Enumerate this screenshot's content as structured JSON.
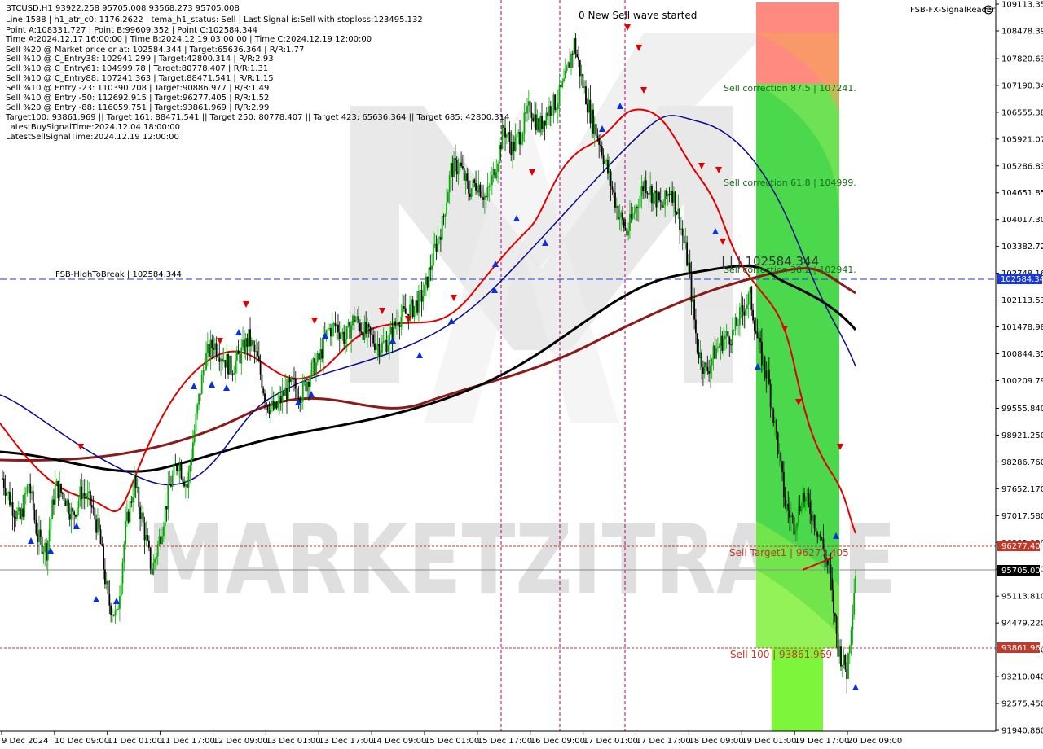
{
  "info_panel": {
    "lines": [
      "BTCUSD,H1  93922.258 95705.008 93568.273 95705.008",
      "Line:1588 | h1_atr_c0: 1176.2622 | tema_h1_status: Sell | Last Signal is:Sell with stoploss:123495.132",
      "Point A:108331.727 | Point B:99609.352 | Point C:102584.344",
      "Time A:2024.12.17 16:00:00 | Time B:2024.12.19 03:00:00 | Time C:2024.12.19 12:00:00",
      "Sell %20 @ Market price or at: 102584.344 | Target:65636.364 | R/R:1.77",
      "Sell %10 @ C_Entry38: 102941.299 | Target:42800.314 | R/R:2.93",
      "Sell %10 @ C_Entry61: 104999.78 | Target:80778.407 | R/R:1.31",
      "Sell %10 @ C_Entry88: 107241.363 | Target:88471.541 | R/R:1.15",
      "Sell %10 @ Entry -23: 110390.208 | Target:90886.977 | R/R:1.49",
      "Sell %10 @ Entry -50: 112692.915 | Target:96277.405 | R/R:1.52",
      "Sell %20 @ Entry -88: 116059.751 | Target:93861.969 | R/R:2.99",
      "Target100: 93861.969 || Target 161: 88471.541 || Target 250: 80778.407 || Target 423: 65636.364 || Target 685: 42800.314",
      "LatestBuySignalTime:2024.12.04 18:00:00",
      "LatestSellSignalTime:2024.12.19 12:00:00"
    ]
  },
  "indicator_name": "FSB-FX-SignalReader",
  "wave_label": "0 New Sell wave started",
  "watermark": "MARKETZITRADE",
  "fib_labels": {
    "sell_87": "Sell correction 87.5 | 107241.",
    "sell_61": "Sell correction 61.8 | 104999.",
    "sell_38": "Sell correction 38.2 | 102941.",
    "point_c": "| | | 102584.344",
    "target1": "Sell Target1 | 96277.405",
    "sell100": "Sell 100 | 93861.969"
  },
  "high_to_break_label": "FSB-HighToBreak | 102584.344",
  "price_tags": {
    "high_to_break": "102584.344",
    "target1": "96277.405",
    "current": "95705.008",
    "sell100": "93861.969"
  },
  "colors": {
    "bull_candle": "#00aa00",
    "bear_candle": "#000000",
    "ema_fast": "#e00000",
    "ema_slow": "#0a0a8c",
    "ma_long": "#000000",
    "ma_longer": "#8b1a1a",
    "buy_arrow": "#0a2ee0",
    "sell_arrow": "#e00000",
    "tag_blue": "#1a3ad6",
    "tag_red": "#c0392b",
    "sell_zone_red": "#ff8a80",
    "sell_zone_green": "#4cd84c"
  },
  "chart_data": {
    "type": "candlestick",
    "symbol": "BTCUSD",
    "timeframe": "H1",
    "ylim": [
      91940.86,
      109113.35
    ],
    "y_ticks": [
      "109113.350",
      "108478.390",
      "107820.630",
      "107190.345",
      "106555.380",
      "105921.070",
      "105286.830",
      "104651.850",
      "104017.300",
      "103382.720",
      "102748.160",
      "102113.530",
      "101478.980",
      "100844.350",
      "100209.790",
      "99555.840",
      "98921.250",
      "98286.760",
      "97652.170",
      "97017.580",
      "96382.990",
      "95748.400",
      "95113.810",
      "94479.220",
      "93844.630",
      "93210.040",
      "92575.450",
      "91940.860"
    ],
    "x_ticks": [
      "9 Dec 2024",
      "10 Dec 09:00",
      "11 Dec 01:00",
      "11 Dec 17:00",
      "12 Dec 09:00",
      "13 Dec 01:00",
      "13 Dec 17:00",
      "14 Dec 09:00",
      "15 Dec 01:00",
      "15 Dec 17:00",
      "16 Dec 09:00",
      "17 Dec 01:00",
      "17 Dec 17:00",
      "18 Dec 09:00",
      "19 Dec 01:00",
      "19 Dec 17:00",
      "20 Dec 09:00"
    ],
    "levels": {
      "high_to_break": 102584.344,
      "sell_target1": 96277.405,
      "current_price": 95705.008,
      "sell_100": 93861.969
    },
    "close_path": [
      [
        0,
        97900
      ],
      [
        6,
        97300
      ],
      [
        12,
        96900
      ],
      [
        18,
        97800
      ],
      [
        24,
        96500
      ],
      [
        30,
        96200
      ],
      [
        36,
        97700
      ],
      [
        42,
        97500
      ],
      [
        48,
        97000
      ],
      [
        54,
        97600
      ],
      [
        60,
        97300
      ],
      [
        66,
        96600
      ],
      [
        72,
        95000
      ],
      [
        78,
        94600
      ],
      [
        84,
        96700
      ],
      [
        90,
        97800
      ],
      [
        96,
        96800
      ],
      [
        102,
        95700
      ],
      [
        108,
        96600
      ],
      [
        114,
        97700
      ],
      [
        120,
        98300
      ],
      [
        126,
        97700
      ],
      [
        132,
        99300
      ],
      [
        138,
        100700
      ],
      [
        144,
        101100
      ],
      [
        150,
        100800
      ],
      [
        156,
        100500
      ],
      [
        162,
        100800
      ],
      [
        168,
        101200
      ],
      [
        174,
        100700
      ],
      [
        180,
        99700
      ],
      [
        186,
        99500
      ],
      [
        192,
        99900
      ],
      [
        198,
        100100
      ],
      [
        204,
        99900
      ],
      [
        210,
        100400
      ],
      [
        216,
        100700
      ],
      [
        222,
        101400
      ],
      [
        228,
        101500
      ],
      [
        234,
        101200
      ],
      [
        240,
        101700
      ],
      [
        246,
        101400
      ],
      [
        252,
        101200
      ],
      [
        258,
        101000
      ],
      [
        264,
        101200
      ],
      [
        270,
        101700
      ],
      [
        276,
        101800
      ],
      [
        282,
        102000
      ],
      [
        288,
        102300
      ],
      [
        294,
        103200
      ],
      [
        300,
        103900
      ],
      [
        306,
        105200
      ],
      [
        312,
        105300
      ],
      [
        318,
        104700
      ],
      [
        324,
        104900
      ],
      [
        330,
        104500
      ],
      [
        336,
        105200
      ],
      [
        342,
        106200
      ],
      [
        348,
        105700
      ],
      [
        354,
        106100
      ],
      [
        360,
        106700
      ],
      [
        366,
        106200
      ],
      [
        372,
        106600
      ],
      [
        378,
        106800
      ],
      [
        384,
        107300
      ],
      [
        390,
        108200
      ],
      [
        396,
        107200
      ],
      [
        402,
        106400
      ],
      [
        408,
        105800
      ],
      [
        414,
        105000
      ],
      [
        420,
        104200
      ],
      [
        426,
        103700
      ],
      [
        432,
        104300
      ],
      [
        438,
        104900
      ],
      [
        444,
        104600
      ],
      [
        450,
        104300
      ],
      [
        456,
        104800
      ],
      [
        462,
        104000
      ],
      [
        468,
        102900
      ],
      [
        474,
        101000
      ],
      [
        480,
        100400
      ],
      [
        486,
        100900
      ],
      [
        492,
        101200
      ],
      [
        498,
        101300
      ],
      [
        504,
        101800
      ],
      [
        510,
        102200
      ],
      [
        516,
        101000
      ],
      [
        522,
        100300
      ],
      [
        528,
        98900
      ],
      [
        534,
        97300
      ],
      [
        540,
        96800
      ],
      [
        546,
        97500
      ],
      [
        552,
        97100
      ],
      [
        558,
        96500
      ],
      [
        564,
        95700
      ],
      [
        570,
        93900
      ],
      [
        576,
        93300
      ],
      [
        582,
        95705
      ]
    ]
  }
}
